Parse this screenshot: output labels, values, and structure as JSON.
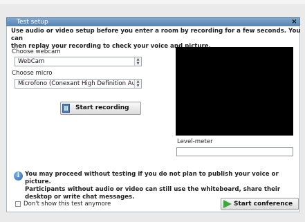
{
  "dialog": {
    "title": "Test setup",
    "close_symbol": "×",
    "intro_line1": "Use audio or video setup before you enter a room by recording for a few seconds. You can",
    "intro_line2": "then replay your recording to check your voice and picture."
  },
  "webcam": {
    "label": "Choose webcam",
    "value": "WebCam"
  },
  "micro": {
    "label": "Choose micro",
    "value": "Microfono (Conexant High Definition Aud"
  },
  "record_button": {
    "label": "Start recording",
    "icon": "record-icon"
  },
  "level_meter": {
    "label": "Level-meter"
  },
  "info": {
    "icon": "info-icon",
    "line1": "You may proceed without testing if you do not plan to publish your voice or picture.",
    "line2": "Participants without audio or video can still use the whiteboard, share their",
    "line3": "desktop or write chat messages."
  },
  "dont_show": {
    "label": "Don't show this test anymore",
    "checked": false
  },
  "conference_button": {
    "label": "Start conference",
    "icon": "play-icon"
  }
}
